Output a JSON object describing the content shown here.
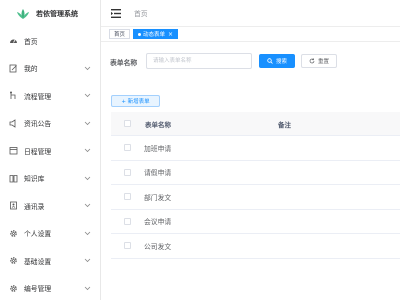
{
  "app": {
    "title": "若依管理系统",
    "accent": "#1890ff"
  },
  "sidebar": {
    "items": [
      {
        "label": "首页",
        "icon": "dashboard-icon",
        "has_children": false
      },
      {
        "label": "我的",
        "icon": "edit-icon",
        "has_children": true
      },
      {
        "label": "流程管理",
        "icon": "flow-icon",
        "has_children": true
      },
      {
        "label": "资讯公告",
        "icon": "speaker-icon",
        "has_children": true
      },
      {
        "label": "日程管理",
        "icon": "calendar-icon",
        "has_children": true
      },
      {
        "label": "知识库",
        "icon": "book-icon",
        "has_children": true
      },
      {
        "label": "通讯录",
        "icon": "contacts-icon",
        "has_children": true
      },
      {
        "label": "个人设置",
        "icon": "gear-icon",
        "has_children": true
      },
      {
        "label": "基础设置",
        "icon": "gear-icon",
        "has_children": true
      },
      {
        "label": "编号管理",
        "icon": "gear-icon",
        "has_children": true
      }
    ]
  },
  "topbar": {
    "breadcrumb": "首页"
  },
  "tabs": [
    {
      "label": "首页",
      "active": false
    },
    {
      "label": "动态表单",
      "active": true
    }
  ],
  "search": {
    "label": "表单名称",
    "placeholder": "请输入表单名称",
    "value": "",
    "search_button": "搜索",
    "reset_button": "重置"
  },
  "toolbar": {
    "add_button": "+ 新增表单"
  },
  "table": {
    "columns": [
      "表单名称",
      "备注"
    ],
    "rows": [
      {
        "name": "加班申请",
        "remark": ""
      },
      {
        "name": "请假申请",
        "remark": ""
      },
      {
        "name": "部门发文",
        "remark": ""
      },
      {
        "name": "会议申请",
        "remark": ""
      },
      {
        "name": "公司发文",
        "remark": ""
      }
    ]
  }
}
